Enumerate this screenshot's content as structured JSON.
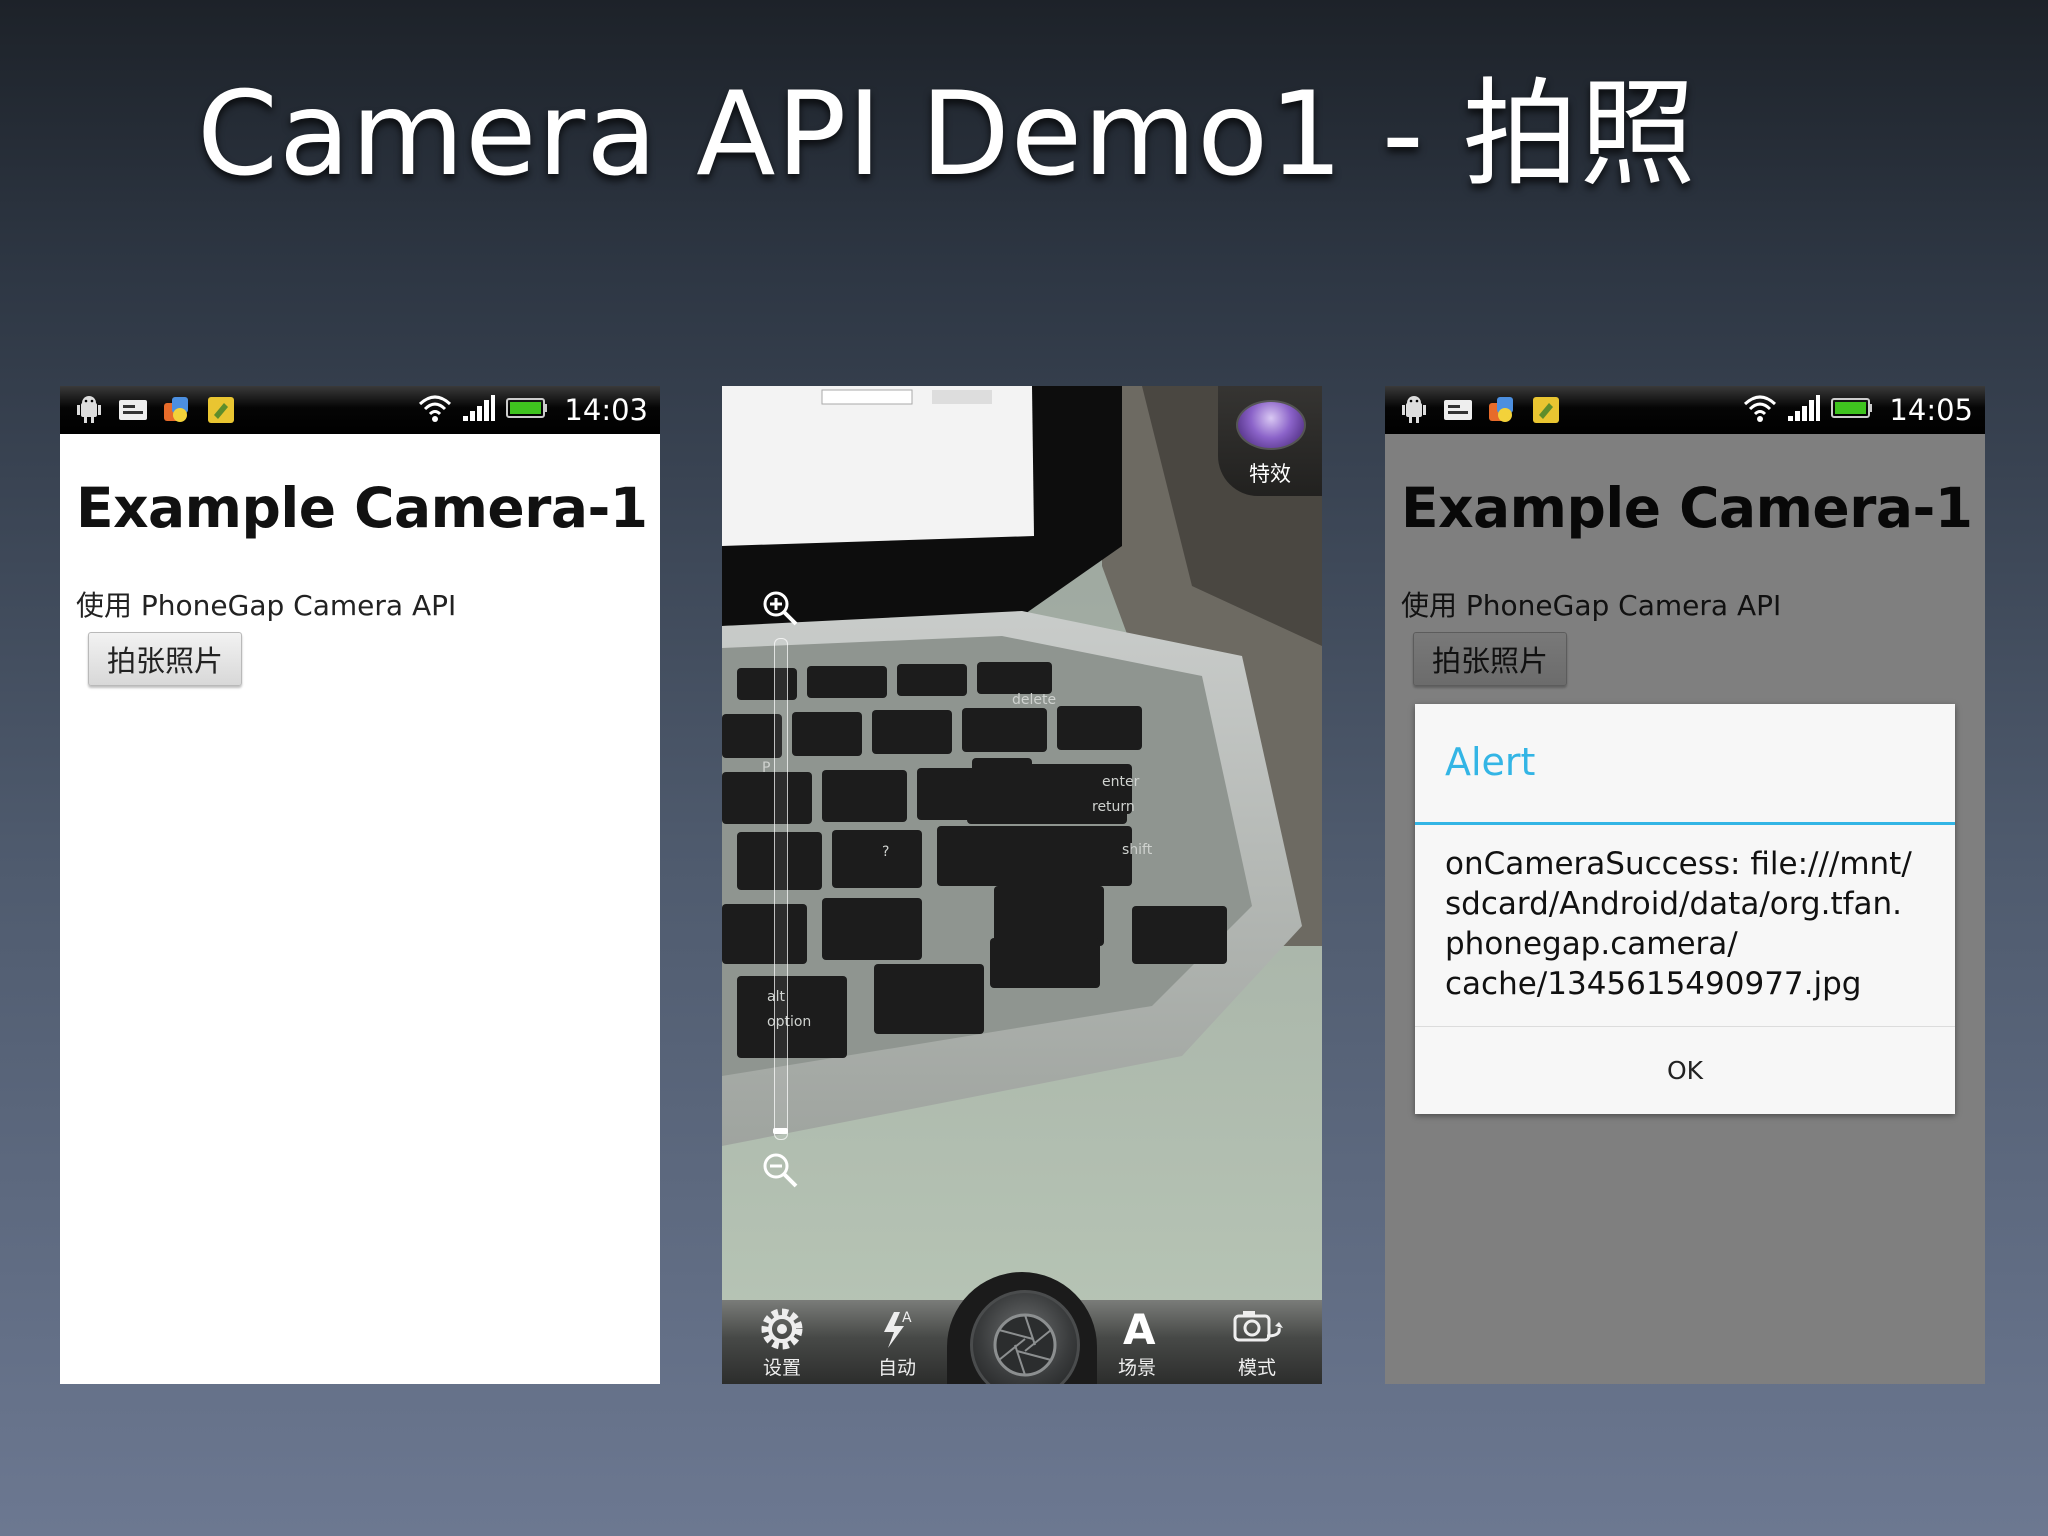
{
  "slide": {
    "title": "Camera API Demo1 - 拍照"
  },
  "status_icons": [
    "android-debug-icon",
    "sms-icon",
    "app-launcher-icon",
    "notes-icon",
    "wifi-icon",
    "signal-icon",
    "battery-icon"
  ],
  "phone1": {
    "time": "14:03",
    "heading": "Example Camera-1",
    "subtitle": "使用 PhoneGap Camera API",
    "button": "拍张照片"
  },
  "phone2": {
    "effect_label": "特效",
    "toolbar": [
      {
        "label": "设置",
        "icon": "gear-icon"
      },
      {
        "label": "自动",
        "icon": "flash-auto-icon"
      },
      {
        "label": "场景",
        "icon": "scene-icon"
      },
      {
        "label": "模式",
        "icon": "camera-mode-icon"
      }
    ]
  },
  "phone3": {
    "time": "14:05",
    "heading": "Example Camera-1",
    "subtitle": "使用 PhoneGap Camera API",
    "button": "拍张照片",
    "dialog": {
      "title": "Alert",
      "message_lines": [
        "onCameraSuccess: file:///mnt/",
        "sdcard/Android/data/org.tfan.",
        "phonegap.camera/",
        "cache/1345615490977.jpg"
      ],
      "ok": "OK"
    }
  },
  "colors": {
    "dialog_accent": "#33b5e5",
    "battery": "#3fc31f"
  }
}
